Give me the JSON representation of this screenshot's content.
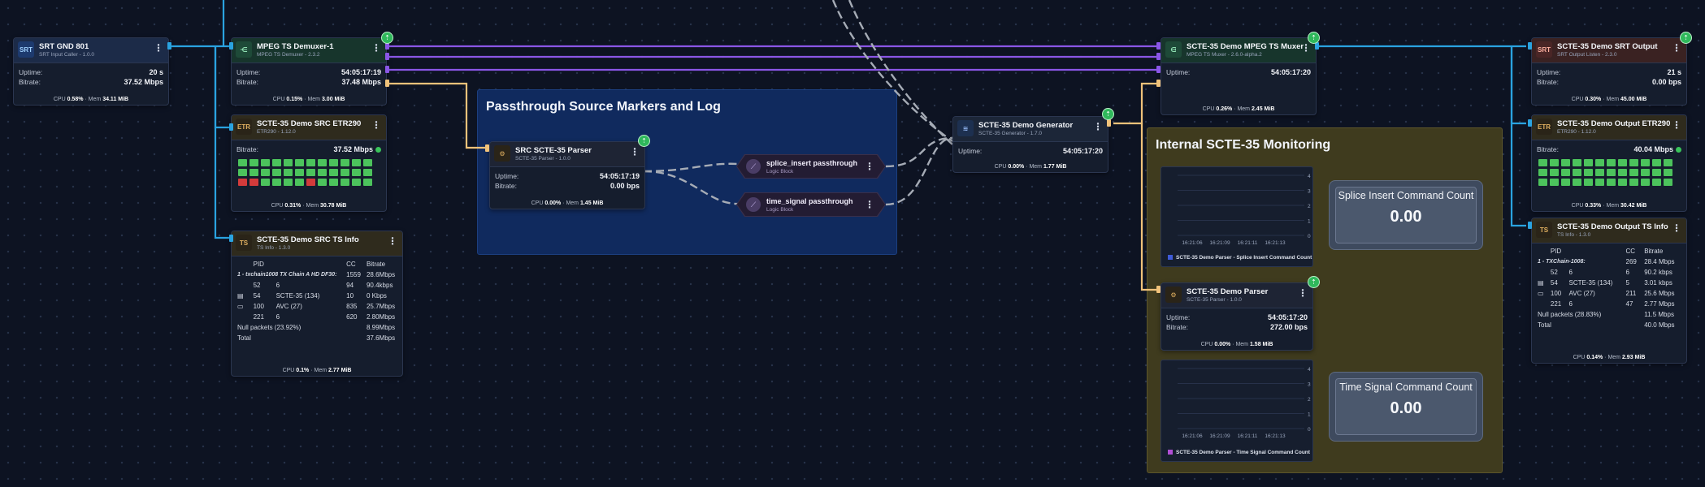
{
  "groups": {
    "passthrough": {
      "title": "Passthrough Source Markers and Log"
    },
    "monitoring": {
      "title": "Internal SCTE-35 Monitoring"
    }
  },
  "nodes": {
    "srt_gnd": {
      "title": "SRT GND 801",
      "subtitle": "SRT Input Caller - 1.0.0",
      "icon": "SRT",
      "uptime_label": "Uptime:",
      "uptime": "20 s",
      "bitrate_label": "Bitrate:",
      "bitrate": "37.52 Mbps",
      "cpu_label": "CPU",
      "cpu": "0.58%",
      "mem_label": "· Mem",
      "mem": "34.11 MiB"
    },
    "demuxer": {
      "title": "MPEG TS Demuxer-1",
      "subtitle": "MPEG TS Demuxer - 2.3.2",
      "uptime_label": "Uptime:",
      "uptime": "54:05:17:19",
      "bitrate_label": "Bitrate:",
      "bitrate": "37.48 Mbps",
      "cpu_label": "CPU",
      "cpu": "0.15%",
      "mem_label": "· Mem",
      "mem": "3.00 MiB"
    },
    "src_etr290": {
      "title": "SCTE-35 Demo SRC ETR290",
      "subtitle": "ETR290 - 1.12.0",
      "bitrate_label": "Bitrate:",
      "bitrate": "37.52 Mbps",
      "cpu_label": "CPU",
      "cpu": "0.31%",
      "mem_label": "· Mem",
      "mem": "30.78 MiB"
    },
    "src_tsinfo": {
      "title": "SCTE-35 Demo SRC TS Info",
      "subtitle": "TS Info - 1.3.0",
      "head_pid": "PID",
      "head_cc": "CC",
      "head_bitrate": "Bitrate",
      "prog": "1 - txchain1008 TX Chain A HD DF30:",
      "prog_cc": "1559",
      "prog_bitrate": "28.6Mbps",
      "rows": [
        {
          "pid": "52",
          "type": "6",
          "cc": "94",
          "bitrate": "90.4kbps"
        },
        {
          "pid": "54",
          "type": "SCTE-35 (134)",
          "cc": "10",
          "bitrate": "0    Kbps"
        },
        {
          "pid": "100",
          "type": "AVC (27)",
          "cc": "835",
          "bitrate": "25.7Mbps"
        },
        {
          "pid": "221",
          "type": "6",
          "cc": "620",
          "bitrate": "2.80Mbps"
        }
      ],
      "null_label": "Null packets (23.92%)",
      "null_bitrate": "8.99Mbps",
      "total_label": "Total",
      "total_bitrate": "37.6Mbps",
      "cpu_label": "CPU",
      "cpu": "0.1%",
      "mem_label": "· Mem",
      "mem": "2.77 MiB"
    },
    "src_parser": {
      "title": "SRC SCTE-35 Parser",
      "subtitle": "SCTE-35 Parser - 1.0.0",
      "uptime_label": "Uptime:",
      "uptime": "54:05:17:19",
      "bitrate_label": "Bitrate:",
      "bitrate": "0.00 bps",
      "cpu_label": "CPU",
      "cpu": "0.00%",
      "mem_label": "· Mem",
      "mem": "1.45 MiB"
    },
    "splice_logic": {
      "title": "splice_insert passthrough",
      "subtitle": "Logic Block"
    },
    "signal_logic": {
      "title": "time_signal passthrough",
      "subtitle": "Logic Block"
    },
    "generator": {
      "title": "SCTE-35 Demo Generator",
      "subtitle": "SCTE-35 Generator - 1.7.0",
      "uptime_label": "Uptime:",
      "uptime": "54:05:17:20",
      "cpu_label": "CPU",
      "cpu": "0.00%",
      "mem_label": "· Mem",
      "mem": "1.77 MiB"
    },
    "muxer": {
      "title": "SCTE-35 Demo MPEG TS Muxer",
      "subtitle": "MPEG TS Muxer - 2.6.0-alpha.2",
      "uptime_label": "Uptime:",
      "uptime": "54:05:17:20",
      "cpu_label": "CPU",
      "cpu": "0.26%",
      "mem_label": "· Mem",
      "mem": "2.45 MiB"
    },
    "demo_parser": {
      "title": "SCTE-35 Demo Parser",
      "subtitle": "SCTE-35 Parser - 1.0.0",
      "uptime_label": "Uptime:",
      "uptime": "54:05:17:20",
      "bitrate_label": "Bitrate:",
      "bitrate": "272.00 bps",
      "cpu_label": "CPU",
      "cpu": "0.00%",
      "mem_label": "· Mem",
      "mem": "1.58 MiB"
    },
    "srt_output": {
      "title": "SCTE-35 Demo SRT Output",
      "subtitle": "SRT Output Listen - 2.3.0",
      "icon": "SRT",
      "uptime_label": "Uptime:",
      "uptime": "21 s",
      "bitrate_label": "Bitrate:",
      "bitrate": "0.00 bps",
      "cpu_label": "CPU",
      "cpu": "0.30%",
      "mem_label": "· Mem",
      "mem": "45.00 MiB"
    },
    "out_etr290": {
      "title": "SCTE-35 Demo Output ETR290",
      "subtitle": "ETR290 - 1.12.0",
      "bitrate_label": "Bitrate:",
      "bitrate": "40.04 Mbps",
      "cpu_label": "CPU",
      "cpu": "0.33%",
      "mem_label": "· Mem",
      "mem": "30.42 MiB"
    },
    "out_tsinfo": {
      "title": "SCTE-35 Demo Output TS Info",
      "subtitle": "TS Info - 1.3.0",
      "head_pid": "PID",
      "head_cc": "CC",
      "head_bitrate": "Bitrate",
      "prog": "1 - TXChain-1008:",
      "prog_cc": "269",
      "prog_bitrate": "28.4 Mbps",
      "rows": [
        {
          "pid": "52",
          "type": "6",
          "cc": "6",
          "bitrate": "90.2 kbps"
        },
        {
          "pid": "54",
          "type": "SCTE-35 (134)",
          "cc": "5",
          "bitrate": "3.01 kbps"
        },
        {
          "pid": "100",
          "type": "AVC (27)",
          "cc": "211",
          "bitrate": "25.6 Mbps"
        },
        {
          "pid": "221",
          "type": "6",
          "cc": "47",
          "bitrate": "2.77 Mbps"
        }
      ],
      "null_label": "Null packets (28.83%)",
      "null_bitrate": "11.5 Mbps",
      "total_label": "Total",
      "total_bitrate": "40.0 Mbps",
      "cpu_label": "CPU",
      "cpu": "0.14%",
      "mem_label": "· Mem",
      "mem": "2.93 MiB"
    }
  },
  "src_etr290_status": [
    1,
    1,
    1,
    1,
    1,
    1,
    1,
    1,
    1,
    1,
    1,
    1,
    1,
    1,
    1,
    1,
    1,
    1,
    1,
    1,
    1,
    1,
    1,
    1,
    0,
    0,
    1,
    1,
    1,
    1,
    0,
    1,
    1,
    1,
    1,
    1
  ],
  "out_etr290_status": [
    1,
    1,
    1,
    1,
    1,
    1,
    1,
    1,
    1,
    1,
    1,
    1,
    1,
    1,
    1,
    1,
    1,
    1,
    1,
    1,
    1,
    1,
    1,
    1,
    1,
    1,
    1,
    1,
    1,
    1,
    1,
    1,
    1,
    1,
    1,
    1
  ],
  "charts": {
    "splice": {
      "legend": "SCTE-35 Demo Parser - Splice Insert Command Count",
      "color": "#3f5bd9",
      "yticks": [
        "4",
        "3",
        "2",
        "1",
        "0"
      ],
      "xticks": [
        "16:21:06",
        "16:21:09",
        "16:21:11",
        "16:21:13"
      ]
    },
    "signal": {
      "legend": "SCTE-35 Demo Parser - Time Signal Command Count",
      "color": "#b24fd6",
      "yticks": [
        "4",
        "3",
        "2",
        "1",
        "0"
      ],
      "xticks": [
        "16:21:06",
        "16:21:09",
        "16:21:11",
        "16:21:13"
      ]
    }
  },
  "stats": {
    "splice": {
      "title": "Splice Insert Command Count",
      "value": "0.00"
    },
    "signal": {
      "title": "Time Signal Command Count",
      "value": "0.00"
    }
  },
  "colors": {
    "video": "#2aa3e0",
    "data": "#f0c27a",
    "es": "#8a56e6",
    "cloud": "#2fb85b"
  }
}
